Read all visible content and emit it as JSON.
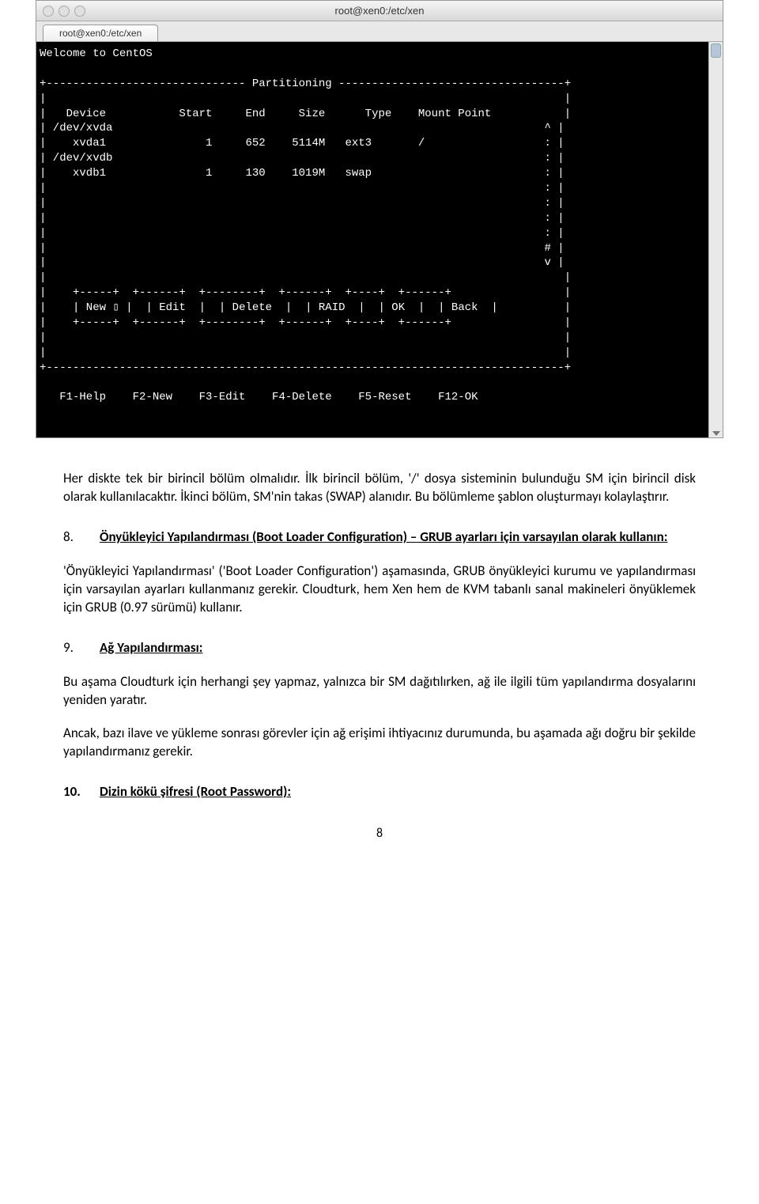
{
  "window": {
    "title": "root@xen0:/etc/xen",
    "tab": "root@xen0:/etc/xen"
  },
  "term": {
    "welcome": "Welcome to CentOS",
    "boxtitle": "Partitioning",
    "headers": {
      "device": "Device",
      "start": "Start",
      "end": "End",
      "size": "Size",
      "type": "Type",
      "mount": "Mount Point"
    },
    "rows": [
      {
        "dev": "/dev/xvda",
        "start": "",
        "end": "",
        "size": "",
        "type": "",
        "mount": "",
        "mark": "^"
      },
      {
        "dev": "   xvda1",
        "start": "1",
        "end": "652",
        "size": "5114M",
        "type": "ext3",
        "mount": "/",
        "mark": ":"
      },
      {
        "dev": "/dev/xvdb",
        "start": "",
        "end": "",
        "size": "",
        "type": "",
        "mount": "",
        "mark": ":"
      },
      {
        "dev": "   xvdb1",
        "start": "1",
        "end": "130",
        "size": "1019M",
        "type": "swap",
        "mount": "",
        "mark": ":"
      }
    ],
    "buttons": {
      "b1": "New",
      "b2": "Edit",
      "b3": "Delete",
      "b4": "RAID",
      "b5": "OK",
      "b6": "Back"
    },
    "fkeys": {
      "f1": "F1-Help",
      "f2": "F2-New",
      "f3": "F3-Edit",
      "f4": "F4-Delete",
      "f5": "F5-Reset",
      "f12": "F12-OK"
    }
  },
  "doc": {
    "p1": "Her diskte tek bir birincil bölüm olmalıdır. İlk birincil bölüm, '/' dosya sisteminin bulunduğu SM için birincil disk olarak kullanılacaktır. İkinci bölüm, SM'nin takas (SWAP) alanıdır. Bu bölümleme şablon oluşturmayı kolaylaştırır.",
    "h8_num": "8.",
    "h8_title": "Önyükleyici Yapılandırması (Boot Loader Configuration) – GRUB ayarları için varsayılan olarak kullanın:",
    "p2": "'Önyükleyici Yapılandırması' ('Boot Loader Configuration') aşamasında, GRUB önyükleyici kurumu ve yapılandırması için varsayılan ayarları kullanmanız gerekir. Cloudturk, hem Xen hem de KVM tabanlı sanal makineleri önyüklemek için GRUB (0.97 sürümü) kullanır.",
    "h9_num": "9.",
    "h9_title": "Ağ Yapılandırması:",
    "p3": "Bu aşama Cloudturk için herhangi şey yapmaz, yalnızca bir SM dağıtılırken, ağ ile ilgili tüm yapılandırma dosyalarını yeniden yaratır.",
    "p4": "Ancak, bazı ilave ve yükleme sonrası görevler için ağ erişimi ihtiyacınız durumunda, bu aşamada ağı doğru bir şekilde yapılandırmanız gerekir.",
    "h10_num": "10.",
    "h10_title": "Dizin kökü şifresi (Root Password):",
    "pagenum": "8"
  }
}
